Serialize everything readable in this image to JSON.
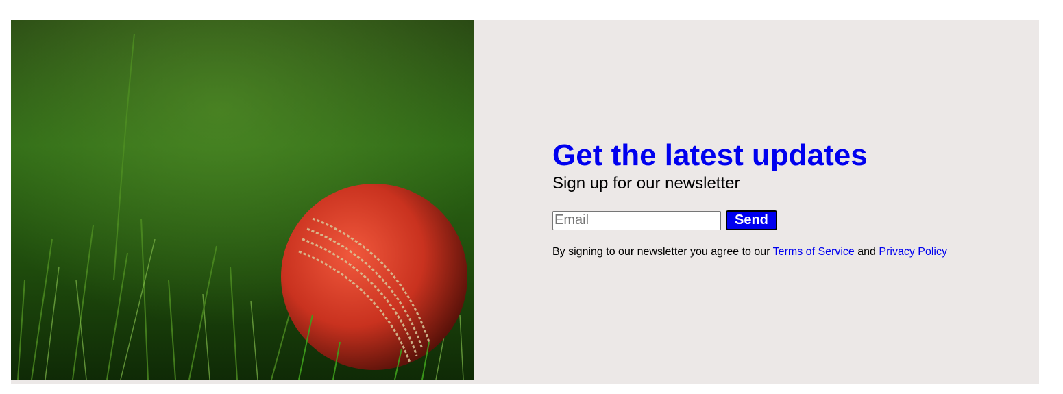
{
  "newsletter": {
    "image": {
      "subject": "cricket-ball-on-grass",
      "alt_colors": {
        "grass_dark": "#163a0c",
        "grass_light": "#5c9a2a",
        "ball": "#c9321f"
      }
    },
    "title": "Get the latest updates",
    "subtitle": "Sign up for our newsletter",
    "email": {
      "placeholder": "Email",
      "value": ""
    },
    "send_label": "Send",
    "legal": {
      "prefix": "By signing to our newsletter you agree to our ",
      "terms_label": "Terms of Service",
      "middle": " and ",
      "privacy_label": "Privacy Policy"
    }
  },
  "colors": {
    "panel_bg": "#ece8e7",
    "accent": "#0000ee",
    "text": "#000000"
  }
}
